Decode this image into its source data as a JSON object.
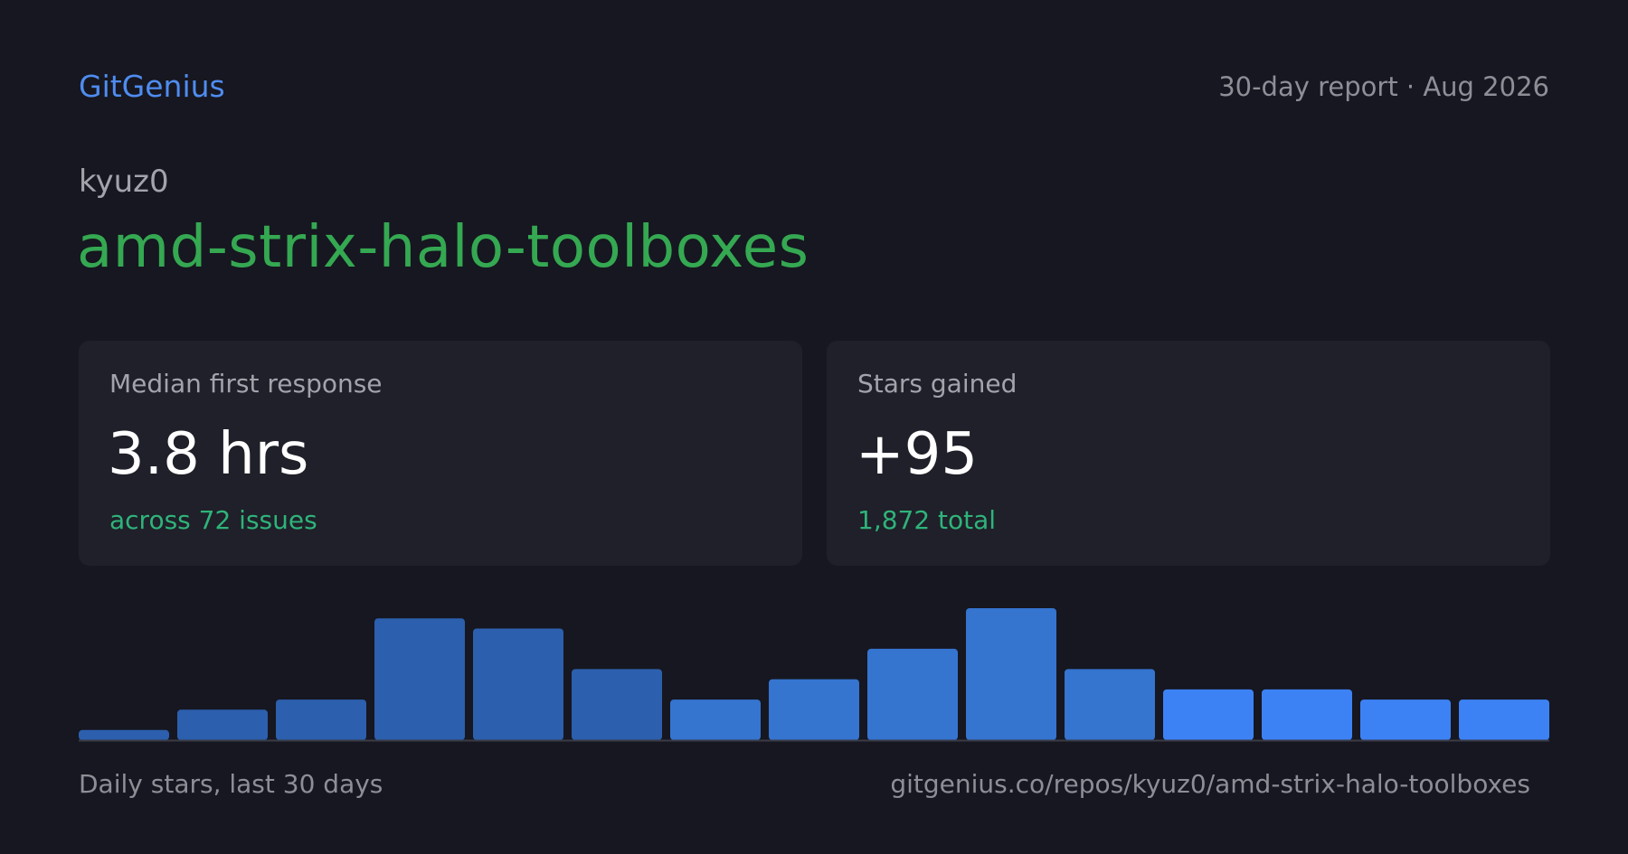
{
  "header": {
    "brand": "GitGenius",
    "report_meta": "30-day report · Aug 2026"
  },
  "repo": {
    "owner": "kyuz0",
    "name": "amd-strix-halo-toolboxes"
  },
  "cards": {
    "response": {
      "label": "Median first response",
      "value": "3.8 hrs",
      "sub": "across 72 issues"
    },
    "stars": {
      "label": "Stars gained",
      "value": "+95",
      "sub": "1,872 total"
    }
  },
  "footer": {
    "caption": "Daily stars, last 30 days",
    "url": "gitgenius.co/repos/kyuz0/amd-strix-halo-toolboxes"
  },
  "colors": {
    "brand": "#4f8cf0",
    "repo_name": "#35a852",
    "accent_green": "#2fb37a",
    "background": "#161720",
    "card_bg": "#1f2029"
  },
  "chart_data": {
    "type": "bar",
    "categories": [],
    "values": [
      1,
      3,
      4,
      12,
      11,
      7,
      4,
      6,
      9,
      13,
      7,
      5,
      5,
      4,
      4
    ],
    "bar_colors": [
      "#2c5fad",
      "#2c5fad",
      "#2c5fad",
      "#2c5fad",
      "#2c5fad",
      "#2c5fad",
      "#3574cf",
      "#3574cf",
      "#3574cf",
      "#3574cf",
      "#3574cf",
      "#3d82f5",
      "#3d82f5",
      "#3d82f5",
      "#3d82f5"
    ],
    "ylim": [
      0,
      13
    ],
    "grid": false,
    "legend": "none"
  }
}
